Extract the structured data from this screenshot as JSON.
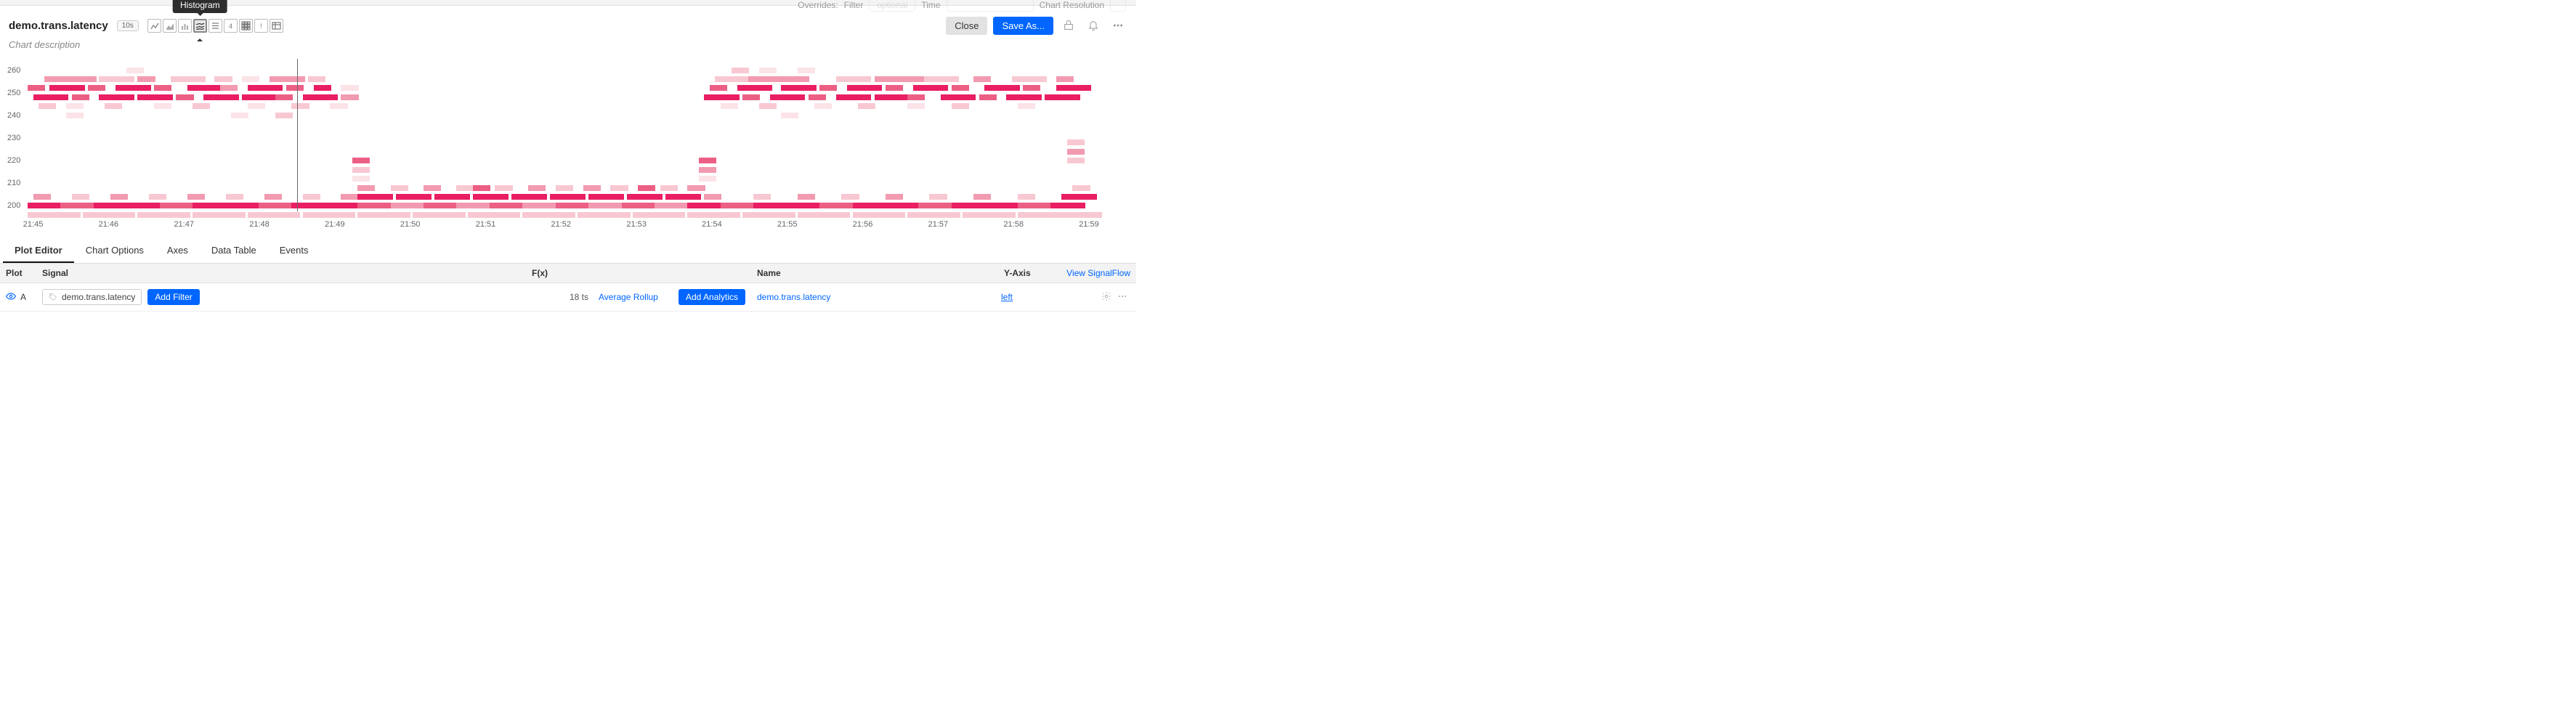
{
  "topstrip": {
    "overrides": "Overrides:",
    "filter": "Filter",
    "optional": "optional",
    "time": "Time",
    "res": "Chart Resolution"
  },
  "header": {
    "title": "demo.trans.latency",
    "interval": "10s",
    "types": [
      {
        "name": "line-chart"
      },
      {
        "name": "area-chart"
      },
      {
        "name": "column-chart"
      },
      {
        "name": "histogram",
        "tooltip": "Histogram",
        "selected": true
      },
      {
        "name": "list-chart"
      },
      {
        "name": "single-value-chart"
      },
      {
        "name": "heatmap-chart"
      },
      {
        "name": "text-chart"
      },
      {
        "name": "table-chart"
      }
    ],
    "close": "Close",
    "save": "Save As..."
  },
  "description": "Chart description",
  "tabs": [
    "Plot Editor",
    "Chart Options",
    "Axes",
    "Data Table",
    "Events"
  ],
  "plotHeader": {
    "plot": "Plot",
    "signal": "Signal",
    "fx": "F(x)",
    "name": "Name",
    "yaxis": "Y-Axis",
    "view": "View SignalFlow"
  },
  "plotRow": {
    "id": "A",
    "signal": "demo.trans.latency",
    "addFilter": "Add Filter",
    "ts": "18 ts",
    "rollup": "Average Rollup",
    "addAnalytics": "Add Analytics",
    "name": "demo.trans.latency",
    "yaxis": "left"
  },
  "chart_data": {
    "type": "heatmap",
    "title": "demo.trans.latency",
    "xlabel": "",
    "ylabel": "",
    "ylim": [
      195,
      265
    ],
    "x_range": [
      "21:45",
      "21:59"
    ],
    "x_ticks": [
      "21:45",
      "21:46",
      "21:47",
      "21:48",
      "21:49",
      "21:50",
      "21:51",
      "21:52",
      "21:53",
      "21:54",
      "21:55",
      "21:56",
      "21:57",
      "21:58",
      "21:59"
    ],
    "y_ticks": [
      200,
      210,
      220,
      230,
      240,
      250,
      260
    ],
    "cursor_x": 0.245,
    "intensity_scale": [
      "#fbe3e8",
      "#f8c8d2",
      "#f29ab0",
      "#ec5f84",
      "#e91e63"
    ],
    "band_height": 8,
    "bands": [
      {
        "y": 260,
        "cells": [
          [
            0.09,
            1,
            1
          ],
          [
            0.64,
            1,
            2
          ],
          [
            0.665,
            1,
            1
          ],
          [
            0.7,
            1,
            1
          ]
        ]
      },
      {
        "y": 256,
        "cells": [
          [
            0.015,
            3,
            3
          ],
          [
            0.065,
            2,
            2
          ],
          [
            0.1,
            1,
            3
          ],
          [
            0.13,
            2,
            2
          ],
          [
            0.17,
            1,
            2
          ],
          [
            0.195,
            1,
            1
          ],
          [
            0.22,
            2,
            3
          ],
          [
            0.255,
            1,
            2
          ],
          [
            0.625,
            2,
            2
          ],
          [
            0.655,
            3,
            3
          ],
          [
            0.695,
            1,
            3
          ],
          [
            0.735,
            2,
            2
          ],
          [
            0.77,
            3,
            3
          ],
          [
            0.815,
            2,
            2
          ],
          [
            0.86,
            1,
            3
          ],
          [
            0.895,
            2,
            2
          ],
          [
            0.935,
            1,
            3
          ]
        ]
      },
      {
        "y": 252,
        "cells": [
          [
            0.0,
            1,
            4
          ],
          [
            0.02,
            2,
            5
          ],
          [
            0.055,
            1,
            4
          ],
          [
            0.08,
            2,
            5
          ],
          [
            0.115,
            1,
            4
          ],
          [
            0.145,
            2,
            5
          ],
          [
            0.175,
            1,
            3
          ],
          [
            0.2,
            2,
            5
          ],
          [
            0.235,
            1,
            4
          ],
          [
            0.26,
            1,
            5
          ],
          [
            0.285,
            1,
            1
          ],
          [
            0.62,
            1,
            4
          ],
          [
            0.645,
            2,
            5
          ],
          [
            0.685,
            2,
            5
          ],
          [
            0.72,
            1,
            4
          ],
          [
            0.745,
            2,
            5
          ],
          [
            0.78,
            1,
            4
          ],
          [
            0.805,
            2,
            5
          ],
          [
            0.84,
            1,
            4
          ],
          [
            0.87,
            2,
            5
          ],
          [
            0.905,
            1,
            4
          ],
          [
            0.935,
            2,
            5
          ]
        ]
      },
      {
        "y": 248,
        "cells": [
          [
            0.005,
            2,
            5
          ],
          [
            0.04,
            1,
            4
          ],
          [
            0.065,
            2,
            5
          ],
          [
            0.1,
            2,
            5
          ],
          [
            0.135,
            1,
            4
          ],
          [
            0.16,
            2,
            5
          ],
          [
            0.195,
            2,
            5
          ],
          [
            0.225,
            1,
            4
          ],
          [
            0.25,
            2,
            5
          ],
          [
            0.285,
            1,
            3
          ],
          [
            0.615,
            2,
            5
          ],
          [
            0.65,
            1,
            4
          ],
          [
            0.675,
            2,
            5
          ],
          [
            0.71,
            1,
            4
          ],
          [
            0.735,
            2,
            5
          ],
          [
            0.77,
            2,
            5
          ],
          [
            0.8,
            1,
            4
          ],
          [
            0.83,
            2,
            5
          ],
          [
            0.865,
            1,
            4
          ],
          [
            0.89,
            2,
            5
          ],
          [
            0.925,
            2,
            5
          ]
        ]
      },
      {
        "y": 244,
        "cells": [
          [
            0.01,
            1,
            2
          ],
          [
            0.035,
            1,
            1
          ],
          [
            0.07,
            1,
            2
          ],
          [
            0.115,
            1,
            1
          ],
          [
            0.15,
            1,
            2
          ],
          [
            0.2,
            1,
            1
          ],
          [
            0.24,
            1,
            2
          ],
          [
            0.275,
            1,
            1
          ],
          [
            0.63,
            1,
            1
          ],
          [
            0.665,
            1,
            2
          ],
          [
            0.715,
            1,
            1
          ],
          [
            0.755,
            1,
            2
          ],
          [
            0.8,
            1,
            1
          ],
          [
            0.84,
            1,
            2
          ],
          [
            0.9,
            1,
            1
          ]
        ]
      },
      {
        "y": 240,
        "cells": [
          [
            0.035,
            1,
            1
          ],
          [
            0.185,
            1,
            1
          ],
          [
            0.225,
            1,
            2
          ],
          [
            0.685,
            1,
            1
          ]
        ]
      },
      {
        "y": 228,
        "cells": [
          [
            0.945,
            1,
            2
          ]
        ]
      },
      {
        "y": 224,
        "cells": [
          [
            0.945,
            1,
            3
          ]
        ]
      },
      {
        "y": 220,
        "cells": [
          [
            0.295,
            1,
            4
          ],
          [
            0.61,
            1,
            4
          ],
          [
            0.945,
            1,
            2
          ]
        ]
      },
      {
        "y": 216,
        "cells": [
          [
            0.295,
            1,
            2
          ],
          [
            0.61,
            1,
            3
          ]
        ]
      },
      {
        "y": 212,
        "cells": [
          [
            0.295,
            1,
            1
          ],
          [
            0.61,
            1,
            1
          ]
        ]
      },
      {
        "y": 208,
        "cells": [
          [
            0.3,
            1,
            3
          ],
          [
            0.33,
            1,
            2
          ],
          [
            0.36,
            1,
            3
          ],
          [
            0.39,
            1,
            2
          ],
          [
            0.405,
            1,
            4
          ],
          [
            0.425,
            1,
            2
          ],
          [
            0.455,
            1,
            3
          ],
          [
            0.48,
            1,
            2
          ],
          [
            0.505,
            1,
            3
          ],
          [
            0.53,
            1,
            2
          ],
          [
            0.555,
            1,
            4
          ],
          [
            0.575,
            1,
            2
          ],
          [
            0.6,
            1,
            3
          ],
          [
            0.95,
            1,
            2
          ]
        ]
      },
      {
        "y": 204,
        "cells": [
          [
            0.005,
            1,
            3
          ],
          [
            0.04,
            1,
            2
          ],
          [
            0.075,
            1,
            3
          ],
          [
            0.11,
            1,
            2
          ],
          [
            0.145,
            1,
            3
          ],
          [
            0.18,
            1,
            2
          ],
          [
            0.215,
            1,
            3
          ],
          [
            0.25,
            1,
            2
          ],
          [
            0.285,
            1,
            3
          ],
          [
            0.3,
            2,
            5
          ],
          [
            0.335,
            2,
            5
          ],
          [
            0.37,
            2,
            5
          ],
          [
            0.405,
            2,
            5
          ],
          [
            0.44,
            2,
            5
          ],
          [
            0.475,
            2,
            5
          ],
          [
            0.51,
            2,
            5
          ],
          [
            0.545,
            2,
            5
          ],
          [
            0.58,
            2,
            5
          ],
          [
            0.615,
            1,
            3
          ],
          [
            0.66,
            1,
            2
          ],
          [
            0.7,
            1,
            3
          ],
          [
            0.74,
            1,
            2
          ],
          [
            0.78,
            1,
            3
          ],
          [
            0.82,
            1,
            2
          ],
          [
            0.86,
            1,
            3
          ],
          [
            0.9,
            1,
            2
          ],
          [
            0.94,
            2,
            5
          ]
        ]
      },
      {
        "y": 200,
        "cells": [
          [
            0.0,
            2,
            5
          ],
          [
            0.03,
            2,
            4
          ],
          [
            0.06,
            2,
            5
          ],
          [
            0.09,
            2,
            5
          ],
          [
            0.12,
            2,
            4
          ],
          [
            0.15,
            2,
            5
          ],
          [
            0.18,
            2,
            5
          ],
          [
            0.21,
            2,
            4
          ],
          [
            0.24,
            2,
            5
          ],
          [
            0.27,
            2,
            5
          ],
          [
            0.3,
            2,
            4
          ],
          [
            0.33,
            2,
            3
          ],
          [
            0.36,
            2,
            4
          ],
          [
            0.39,
            2,
            3
          ],
          [
            0.42,
            2,
            4
          ],
          [
            0.45,
            2,
            3
          ],
          [
            0.48,
            2,
            4
          ],
          [
            0.51,
            2,
            3
          ],
          [
            0.54,
            2,
            4
          ],
          [
            0.57,
            2,
            3
          ],
          [
            0.6,
            2,
            5
          ],
          [
            0.63,
            2,
            4
          ],
          [
            0.66,
            2,
            5
          ],
          [
            0.69,
            2,
            5
          ],
          [
            0.72,
            2,
            4
          ],
          [
            0.75,
            2,
            5
          ],
          [
            0.78,
            2,
            5
          ],
          [
            0.81,
            2,
            4
          ],
          [
            0.84,
            2,
            5
          ],
          [
            0.87,
            2,
            5
          ],
          [
            0.9,
            2,
            4
          ],
          [
            0.93,
            2,
            5
          ]
        ]
      },
      {
        "y": 196,
        "cells": [
          [
            0.0,
            3,
            2
          ],
          [
            0.05,
            3,
            2
          ],
          [
            0.1,
            3,
            2
          ],
          [
            0.15,
            3,
            2
          ],
          [
            0.2,
            3,
            2
          ],
          [
            0.25,
            3,
            2
          ],
          [
            0.3,
            3,
            2
          ],
          [
            0.35,
            3,
            2
          ],
          [
            0.4,
            3,
            2
          ],
          [
            0.45,
            3,
            2
          ],
          [
            0.5,
            3,
            2
          ],
          [
            0.55,
            3,
            2
          ],
          [
            0.6,
            3,
            2
          ],
          [
            0.65,
            3,
            2
          ],
          [
            0.7,
            3,
            2
          ],
          [
            0.75,
            3,
            2
          ],
          [
            0.8,
            3,
            2
          ],
          [
            0.85,
            3,
            2
          ],
          [
            0.9,
            3,
            2
          ],
          [
            0.945,
            2,
            2
          ]
        ]
      }
    ]
  }
}
